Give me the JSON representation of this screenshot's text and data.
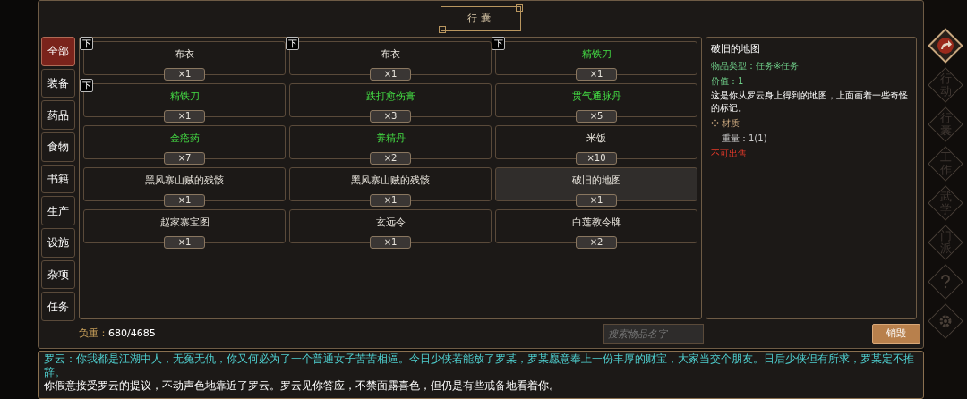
{
  "window": {
    "title": "行囊"
  },
  "categories": [
    {
      "label": "全部",
      "selected": true
    },
    {
      "label": "装备",
      "selected": false
    },
    {
      "label": "药品",
      "selected": false
    },
    {
      "label": "食物",
      "selected": false
    },
    {
      "label": "书籍",
      "selected": false
    },
    {
      "label": "生产",
      "selected": false
    },
    {
      "label": "设施",
      "selected": false
    },
    {
      "label": "杂项",
      "selected": false
    },
    {
      "label": "任务",
      "selected": false
    }
  ],
  "items": [
    {
      "name": "布衣",
      "count": "×1",
      "kind": "common",
      "selected": false,
      "badge": "下"
    },
    {
      "name": "布衣",
      "count": "×1",
      "kind": "common",
      "selected": false,
      "badge": "下"
    },
    {
      "name": "精铁刀",
      "count": "×1",
      "kind": "fine",
      "selected": false,
      "badge": "下"
    },
    {
      "name": "精铁刀",
      "count": "×1",
      "kind": "fine",
      "selected": false,
      "badge": "下"
    },
    {
      "name": "跌打愈伤膏",
      "count": "×3",
      "kind": "fine",
      "selected": false
    },
    {
      "name": "贯气通脉丹",
      "count": "×5",
      "kind": "fine",
      "selected": false
    },
    {
      "name": "金疮药",
      "count": "×7",
      "kind": "fine",
      "selected": false
    },
    {
      "name": "养精丹",
      "count": "×2",
      "kind": "fine",
      "selected": false
    },
    {
      "name": "米饭",
      "count": "×10",
      "kind": "common",
      "selected": false
    },
    {
      "name": "黑风寨山贼的残骸",
      "count": "×1",
      "kind": "common",
      "selected": false
    },
    {
      "name": "黑风寨山贼的残骸",
      "count": "×1",
      "kind": "common",
      "selected": false
    },
    {
      "name": "破旧的地图",
      "count": "×1",
      "kind": "common",
      "selected": true
    },
    {
      "name": "赵家寨宝图",
      "count": "×1",
      "kind": "common",
      "selected": false
    },
    {
      "name": "玄远令",
      "count": "×1",
      "kind": "common",
      "selected": false
    },
    {
      "name": "白莲教令牌",
      "count": "×2",
      "kind": "common",
      "selected": false
    }
  ],
  "detail": {
    "title": "破旧的地图",
    "type": "物品类型：任务※任务",
    "value": "价值：1",
    "description": "这是你从罗云身上得到的地图，上面画着一些奇怪的标记。",
    "section": "材质",
    "weight": "重量：1(1)",
    "warning": "不可出售"
  },
  "load": {
    "label": "负重：",
    "value": "680/4685"
  },
  "search": {
    "placeholder": "搜索物品名字"
  },
  "destroy_button": "销毁",
  "log": [
    {
      "kind": "speech",
      "text": "罗云：你我都是江湖中人，无冤无仇，你又何必为了一个普通女子苦苦相逼。今日少侠若能放了罗某，罗某愿意奉上一份丰厚的财宝，大家当交个朋友。日后少侠但有所求，罗某定不推辞。"
    },
    {
      "kind": "narration",
      "text": "你假意接受罗云的提议，不动声色地靠近了罗云。罗云见你答应，不禁面露喜色，但仍是有些戒备地看着你。"
    }
  ],
  "side_menu": [
    {
      "kind": "back"
    },
    {
      "kind": "label",
      "label": "行动"
    },
    {
      "kind": "label",
      "label": "行囊"
    },
    {
      "kind": "label",
      "label": "工作"
    },
    {
      "kind": "label",
      "label": "武学"
    },
    {
      "kind": "label",
      "label": "门派"
    },
    {
      "kind": "help"
    },
    {
      "kind": "settings"
    }
  ]
}
